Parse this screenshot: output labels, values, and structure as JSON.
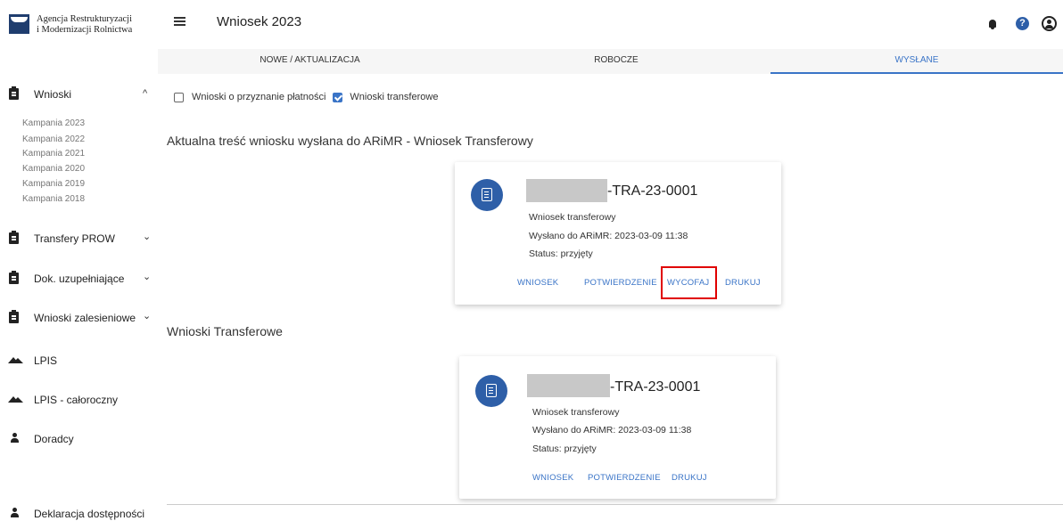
{
  "logo": {
    "line1": "Agencja Restrukturyzacji",
    "line2": "i Modernizacji Rolnictwa"
  },
  "sidebar": {
    "items": [
      {
        "label": "Wnioski",
        "chevron": "^",
        "icon": "clipboard-icon"
      },
      {
        "label": "Transfery PROW",
        "chevron": "⌄",
        "icon": "clipboard-icon"
      },
      {
        "label": "Dok. uzupełniające",
        "chevron": "⌄",
        "icon": "clipboard-icon"
      },
      {
        "label": "Wnioski zalesieniowe",
        "chevron": "⌄",
        "icon": "clipboard-icon"
      },
      {
        "label": "LPIS",
        "icon": "terrain-icon"
      },
      {
        "label": "LPIS - całoroczny",
        "icon": "terrain-icon"
      },
      {
        "label": "Doradcy",
        "icon": "person-icon"
      },
      {
        "label": "Deklaracja dostępności",
        "icon": "accessibility-icon"
      }
    ],
    "campaigns": [
      "Kampania 2023",
      "Kampania 2022",
      "Kampania 2021",
      "Kampania 2020",
      "Kampania 2019",
      "Kampania 2018"
    ]
  },
  "header": {
    "title": "Wniosek 2023"
  },
  "tabs": [
    "NOWE / AKTUALIZACJA",
    "ROBOCZE",
    "WYSŁANE"
  ],
  "filters": {
    "payment_label": "Wnioski o przyznanie płatności",
    "payment_checked": false,
    "transfer_label": "Wnioski transferowe",
    "transfer_checked": true
  },
  "current_section": {
    "heading": "Aktualna treść wniosku wysłana do ARiMR - Wniosek Transferowy",
    "card": {
      "id_suffix": "-TRA-23-0001",
      "type": "Wniosek transferowy",
      "sent": "Wysłano do ARiMR: 2023-03-09 11:38",
      "status": "Status: przyjęty",
      "actions": [
        "WNIOSEK",
        "POTWIERDZENIE",
        "WYCOFAJ",
        "DRUKUJ"
      ]
    }
  },
  "list_section": {
    "heading": "Wnioski Transferowe",
    "card": {
      "id_suffix": "-TRA-23-0001",
      "type": "Wniosek transferowy",
      "sent": "Wysłano do ARiMR: 2023-03-09 11:38",
      "status": "Status: przyjęty",
      "actions": [
        "WNIOSEK",
        "POTWIERDZENIE",
        "DRUKUJ"
      ]
    }
  },
  "colors": {
    "accent": "#3a74c7",
    "icon_circle": "#2e5fa8",
    "highlight": "#e00000"
  }
}
